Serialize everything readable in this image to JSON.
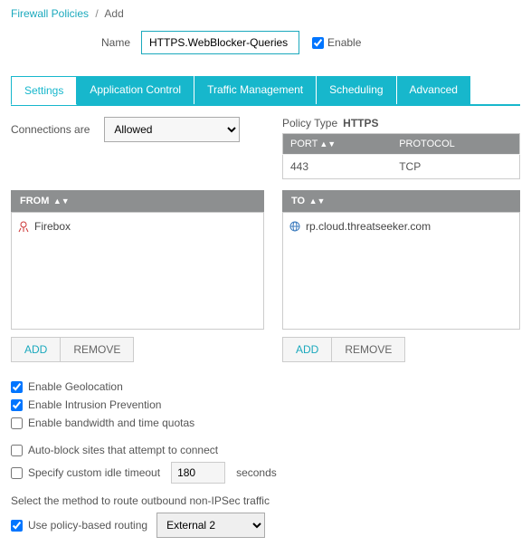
{
  "breadcrumb": {
    "root": "Firewall Policies",
    "current": "Add"
  },
  "name": {
    "label": "Name",
    "value": "HTTPS.WebBlocker-Queries",
    "enable_label": "Enable",
    "enable_checked": true
  },
  "tabs": [
    {
      "label": "Settings",
      "active": true
    },
    {
      "label": "Application Control",
      "active": false
    },
    {
      "label": "Traffic Management",
      "active": false
    },
    {
      "label": "Scheduling",
      "active": false
    },
    {
      "label": "Advanced",
      "active": false
    }
  ],
  "connections": {
    "label": "Connections are",
    "value": "Allowed"
  },
  "policy_type": {
    "label": "Policy Type",
    "value": "HTTPS"
  },
  "port_table": {
    "headers": {
      "port": "PORT",
      "protocol": "PROTOCOL"
    },
    "rows": [
      {
        "port": "443",
        "protocol": "TCP"
      }
    ]
  },
  "from": {
    "header": "FROM",
    "items": [
      {
        "icon": "firebox-icon",
        "label": "Firebox"
      }
    ]
  },
  "to": {
    "header": "TO",
    "items": [
      {
        "icon": "globe-icon",
        "label": "rp.cloud.threatseeker.com"
      }
    ]
  },
  "buttons": {
    "add": "ADD",
    "remove": "REMOVE"
  },
  "checks": {
    "geo": {
      "label": "Enable Geolocation",
      "checked": true
    },
    "ips": {
      "label": "Enable Intrusion Prevention",
      "checked": true
    },
    "quota": {
      "label": "Enable bandwidth and time quotas",
      "checked": false
    },
    "autoblock": {
      "label": "Auto-block sites that attempt to connect",
      "checked": false
    },
    "idle": {
      "label": "Specify custom idle timeout",
      "checked": false,
      "value": "180",
      "unit": "seconds"
    }
  },
  "routing": {
    "prompt": "Select the method to route outbound non-IPSec traffic",
    "pbr": {
      "label": "Use policy-based routing",
      "checked": true,
      "value": "External 2"
    }
  }
}
